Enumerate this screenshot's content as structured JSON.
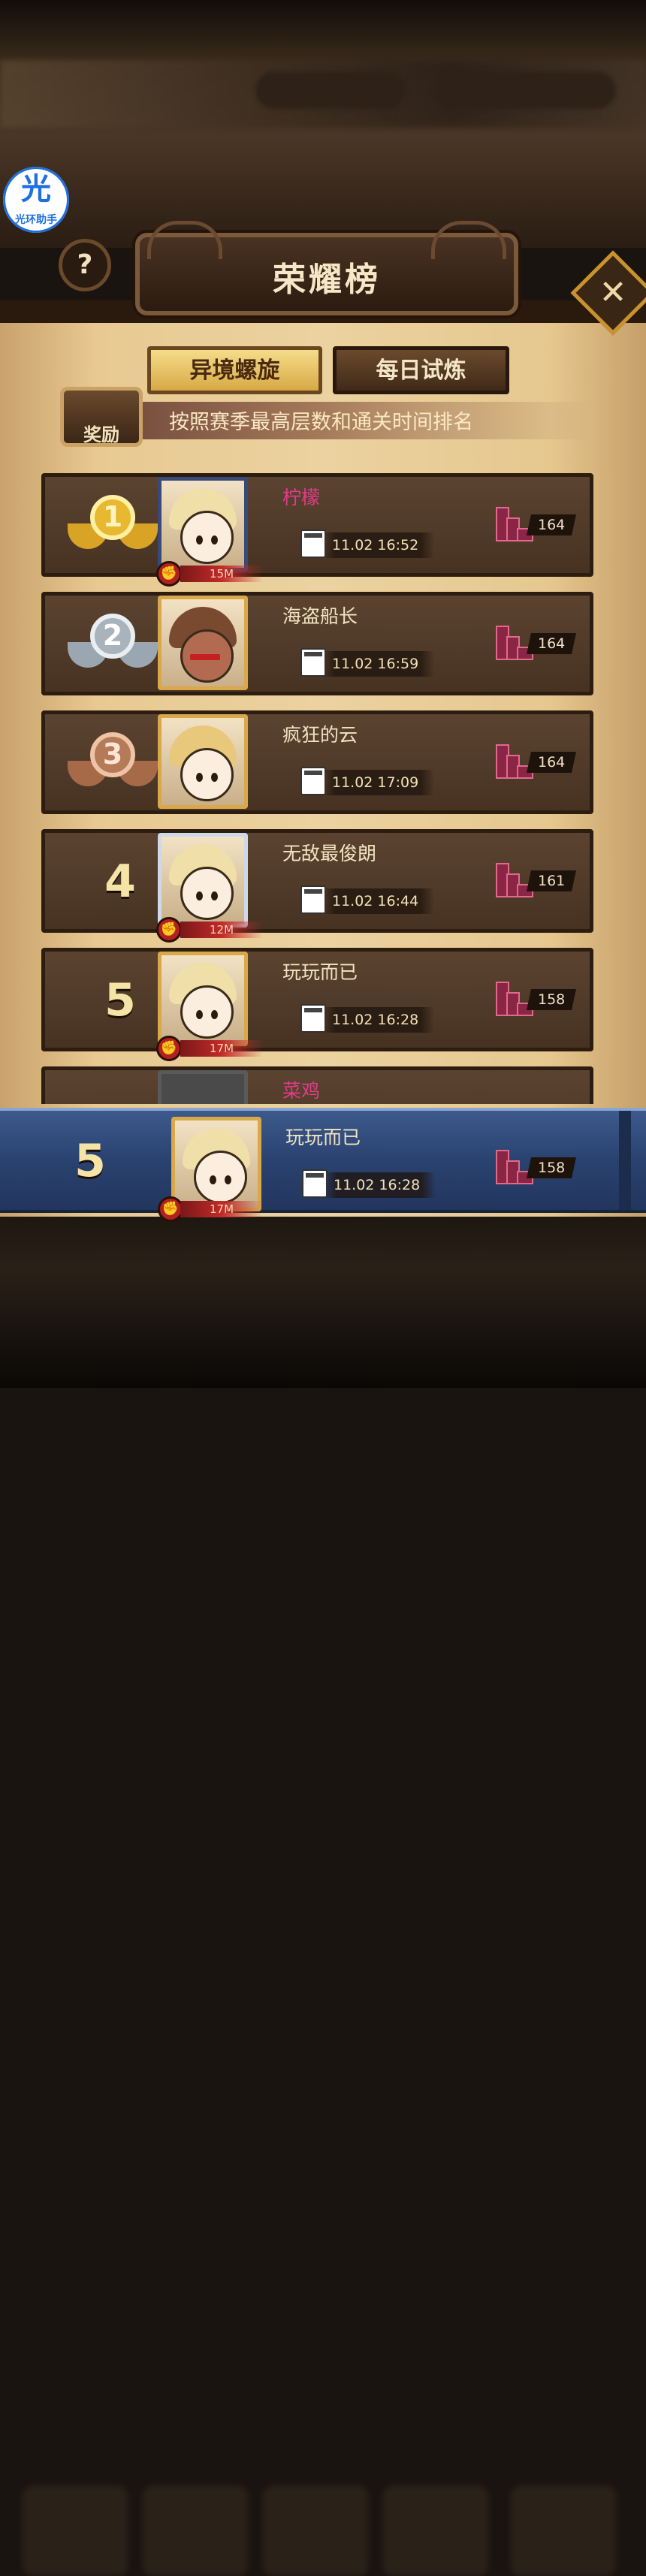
{
  "helper": {
    "glyph": "光",
    "label": "光环助手"
  },
  "help_button": "?",
  "close_button": "✕",
  "title": "荣耀榜",
  "tabs": [
    {
      "label": "异境螺旋",
      "active": true
    },
    {
      "label": "每日试炼",
      "active": false
    }
  ],
  "reward_label": "奖励",
  "subtitle": "按照赛季最高层数和通关时间排名",
  "rank_icons": {
    "power": "fist-icon",
    "date": "calendar-icon",
    "floor": "stairs-icon"
  },
  "leaderboard": [
    {
      "rank": "1",
      "medal": "gold",
      "name": "柠檬",
      "name_color": "#e23c8a",
      "date": "11.02 16:52",
      "power": "15M",
      "floor": "164"
    },
    {
      "rank": "2",
      "medal": "silver",
      "name": "海盗船长",
      "name_color": "#f3e3c2",
      "date": "11.02 16:59",
      "power": "",
      "floor": "164"
    },
    {
      "rank": "3",
      "medal": "bronze",
      "name": "疯狂的云",
      "name_color": "#f3e3c2",
      "date": "11.02 17:09",
      "power": "",
      "floor": "164"
    },
    {
      "rank": "4",
      "medal": "",
      "name": "无敌最俊朗",
      "name_color": "#f3e3c2",
      "date": "11.02 16:44",
      "power": "12M",
      "floor": "161"
    },
    {
      "rank": "5",
      "medal": "",
      "name": "玩玩而已",
      "name_color": "#f3e3c2",
      "date": "11.02 16:28",
      "power": "17M",
      "floor": "158"
    },
    {
      "rank": "",
      "medal": "",
      "name": "菜鸡",
      "name_color": "#e23c8a",
      "date": "",
      "power": "",
      "floor": ""
    }
  ],
  "my_rank": {
    "rank": "5",
    "name": "玩玩而已",
    "date": "11.02 16:28",
    "power": "17M",
    "floor": "158"
  },
  "colors": {
    "tab_active": "#d7a945",
    "panel": "#ebd2a0",
    "my_row": "#2a4270",
    "pink_name": "#e23c8a"
  }
}
